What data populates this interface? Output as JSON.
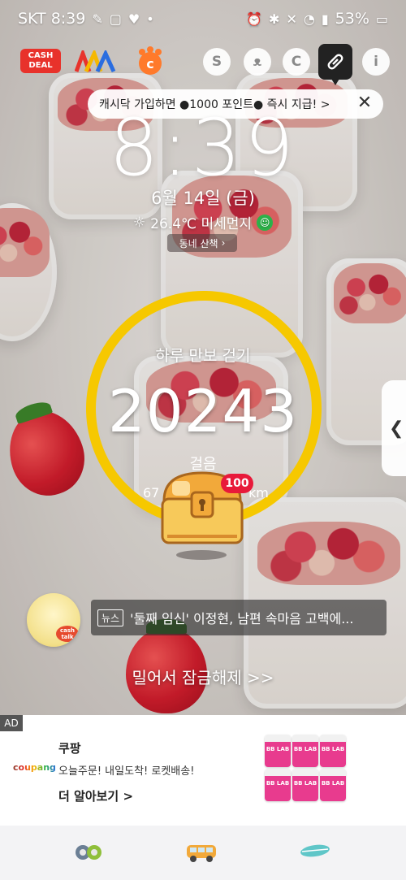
{
  "status_bar": {
    "carrier_time": "SKT 8:39",
    "battery": "53%"
  },
  "top_bar": {
    "cashdeal_label": "CASH DEAL",
    "icons": [
      "cashdeal-logo",
      "m-logo",
      "c-paw-logo",
      "s-icon",
      "cat-icon",
      "c-coin-icon",
      "pill-icon",
      "info-heart-icon"
    ]
  },
  "toast": {
    "text": "캐시닥 가입하면 ●1000 포인트● 즉시 지급! >",
    "close": "✕"
  },
  "clock": {
    "time": "8:39",
    "date": "6월 14일 (금)",
    "weather": "26.4℃ 미세먼지",
    "walk_chip": "동네 산책"
  },
  "steps": {
    "title": "하루 만보 걷기",
    "count": "20243",
    "label": "걸음",
    "distance_left": "67",
    "distance_right": "km",
    "chest_badge": "100"
  },
  "news": {
    "tag": "뉴스",
    "headline": "'둘째 임신' 이정현, 남편 속마음 고백에...",
    "avatar_badge": "cash talk"
  },
  "unlock": {
    "text": "밀어서 잠금해제 >>"
  },
  "ad": {
    "badge": "AD",
    "logo": "coupang",
    "title": "쿠팡",
    "description": "오늘주문! 내일도착! 로켓배송!",
    "link": "더 알아보기 >",
    "product_label": "BB LAB"
  },
  "colors": {
    "ring": "#f6c800",
    "badge": "#e8193a",
    "cashdeal": "#e8322b"
  }
}
